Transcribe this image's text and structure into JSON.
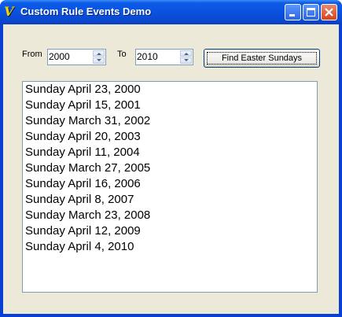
{
  "window": {
    "title": "Custom Rule Events Demo"
  },
  "form": {
    "from_label": "From",
    "from_value": "2000",
    "to_label": "To",
    "to_value": "2010",
    "find_button_label": "Find Easter Sundays"
  },
  "results": [
    "Sunday April 23, 2000",
    "Sunday April 15, 2001",
    "Sunday March 31, 2002",
    "Sunday April 20, 2003",
    "Sunday April 11, 2004",
    "Sunday March 27, 2005",
    "Sunday April 16, 2006",
    "Sunday April 8, 2007",
    "Sunday March 23, 2008",
    "Sunday April 12, 2009",
    "Sunday April 4, 2010"
  ]
}
